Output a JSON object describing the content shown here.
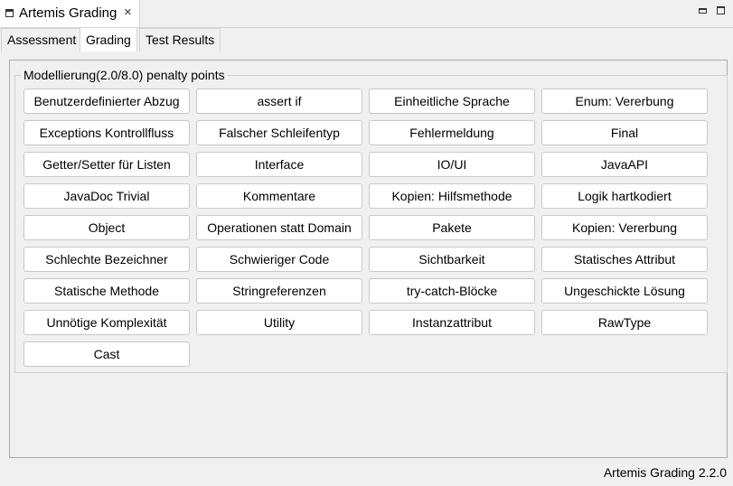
{
  "view": {
    "title": "Artemis Grading",
    "close_glyph": "×"
  },
  "tabs": [
    "Assessment",
    "Grading",
    "Test Results"
  ],
  "active_tab": "Grading",
  "group": {
    "label": "Modellierung(2.0/8.0) penalty points"
  },
  "buttons": [
    "Benutzerdefinierter Abzug",
    "assert if",
    "Einheitliche Sprache",
    "Enum: Vererbung",
    "Exceptions Kontrollfluss",
    "Falscher Schleifentyp",
    "Fehlermeldung",
    "Final",
    "Getter/Setter für Listen",
    "Interface",
    "IO/UI",
    "JavaAPI",
    "JavaDoc Trivial",
    "Kommentare",
    "Kopien: Hilfsmethode",
    "Logik hartkodiert",
    "Object",
    "Operationen statt Domain",
    "Pakete",
    "Kopien: Vererbung",
    "Schlechte Bezeichner",
    "Schwieriger Code",
    "Sichtbarkeit",
    "Statisches Attribut",
    "Statische Methode",
    "Stringreferenzen",
    "try-catch-Blöcke",
    "Ungeschickte Lösung",
    "Unnötige Komplexität",
    "Utility",
    "Instanzattribut",
    "RawType",
    "Cast"
  ],
  "footer": {
    "version_text": "Artemis Grading 2.2.0"
  }
}
